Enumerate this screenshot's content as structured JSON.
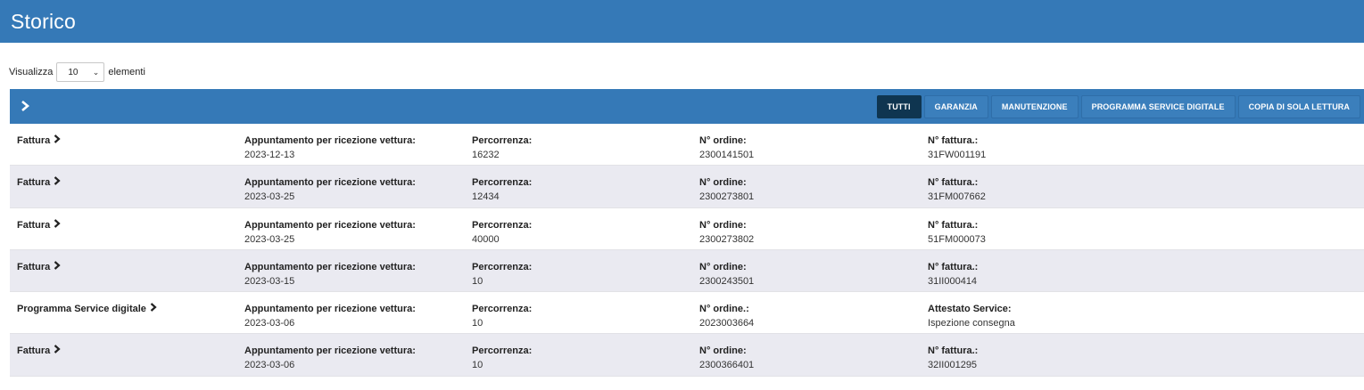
{
  "header": {
    "title": "Storico"
  },
  "length": {
    "prefix": "Visualizza",
    "value": "10",
    "suffix": "elementi"
  },
  "filters": [
    {
      "label": "TUTTI",
      "active": true
    },
    {
      "label": "GARANZIA",
      "active": false
    },
    {
      "label": "MANUTENZIONE",
      "active": false
    },
    {
      "label": "PROGRAMMA SERVICE DIGITALE",
      "active": false
    },
    {
      "label": "COPIA DI SOLA LETTURA",
      "active": false
    }
  ],
  "rows": [
    {
      "type": "Fattura",
      "appt_label": "Appuntamento per ricezione vettura:",
      "appt": "2023-12-13",
      "km_label": "Percorrenza:",
      "km": "16232",
      "order_label": "N° ordine:",
      "order": "2300141501",
      "extra_label": "N° fattura.:",
      "extra": "31FW001191"
    },
    {
      "type": "Fattura",
      "appt_label": "Appuntamento per ricezione vettura:",
      "appt": "2023-03-25",
      "km_label": "Percorrenza:",
      "km": "12434",
      "order_label": "N° ordine:",
      "order": "2300273801",
      "extra_label": "N° fattura.:",
      "extra": "31FM007662"
    },
    {
      "type": "Fattura",
      "appt_label": "Appuntamento per ricezione vettura:",
      "appt": "2023-03-25",
      "km_label": "Percorrenza:",
      "km": "40000",
      "order_label": "N° ordine:",
      "order": "2300273802",
      "extra_label": "N° fattura.:",
      "extra": "51FM000073"
    },
    {
      "type": "Fattura",
      "appt_label": "Appuntamento per ricezione vettura:",
      "appt": "2023-03-15",
      "km_label": "Percorrenza:",
      "km": "10",
      "order_label": "N° ordine:",
      "order": "2300243501",
      "extra_label": "N° fattura.:",
      "extra": "31II000414"
    },
    {
      "type": "Programma Service digitale",
      "appt_label": "Appuntamento per ricezione vettura:",
      "appt": "2023-03-06",
      "km_label": "Percorrenza:",
      "km": "10",
      "order_label": "N° ordine.:",
      "order": "2023003664",
      "extra_label": "Attestato Service:",
      "extra": "Ispezione consegna"
    },
    {
      "type": "Fattura",
      "appt_label": "Appuntamento per ricezione vettura:",
      "appt": "2023-03-06",
      "km_label": "Percorrenza:",
      "km": "10",
      "order_label": "N° ordine:",
      "order": "2300366401",
      "extra_label": "N° fattura.:",
      "extra": "32II001295"
    }
  ]
}
